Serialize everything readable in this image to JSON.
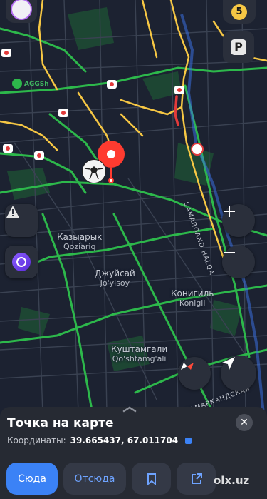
{
  "map": {
    "places": [
      {
        "name": "Казыарык",
        "latin": "Qoziariq"
      },
      {
        "name": "Джуйсай",
        "latin": "Jo'yisoy"
      },
      {
        "name": "Конигиль",
        "latin": "Konigil"
      },
      {
        "name": "Куштамгали",
        "latin": "Qo'shtamg'ali"
      }
    ],
    "roads": [
      "SAMARQAND HALQA",
      "САМАРКАНДСКАЯ"
    ],
    "poi": "AGGSh",
    "traffic_score": "5",
    "parking_label": "P"
  },
  "panel": {
    "title": "Точка на карте",
    "coords_label": "Координаты:",
    "coords_value": "39.665437, 67.011704",
    "close": "✕"
  },
  "actions": {
    "to_here": "Сюда",
    "from_here": "Отсюда"
  },
  "watermark": "olx.uz",
  "colors": {
    "background": "#1c2231",
    "accent_blue": "#3b82f6",
    "pin_red": "#ff3b30",
    "traffic_yellow": "#f6c744",
    "traffic_green": "#2db84b"
  }
}
